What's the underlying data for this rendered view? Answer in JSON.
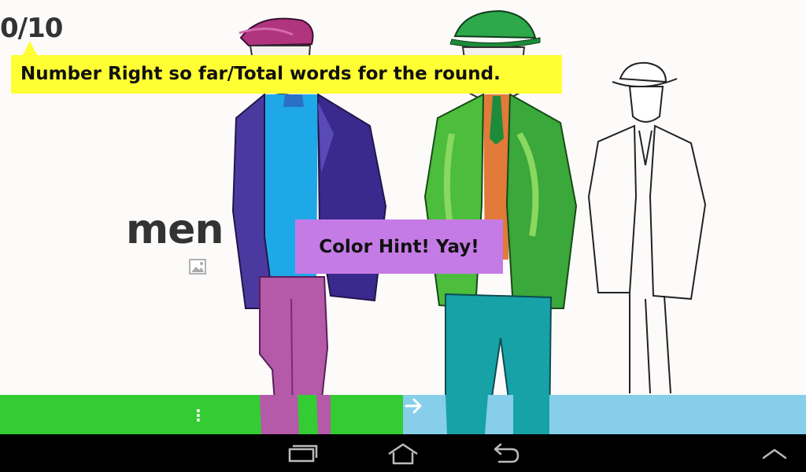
{
  "score": {
    "text": "0/10"
  },
  "tooltip": {
    "text": "Number Right so far/Total words for the round."
  },
  "word": {
    "text": "men"
  },
  "hint": {
    "text": "Color Hint! Yay!"
  },
  "icons": {
    "image": "image-icon",
    "menu": "menu-icon",
    "next": "arrow-right-icon",
    "recents": "recent-apps-icon",
    "home": "home-icon",
    "back": "back-icon",
    "up": "chevron-up-icon"
  },
  "colors": {
    "tooltip_bg": "#ffff33",
    "hint_bg": "#c57be6",
    "left_button_bg": "#33cc33",
    "right_button_bg": "#87ceeb"
  }
}
